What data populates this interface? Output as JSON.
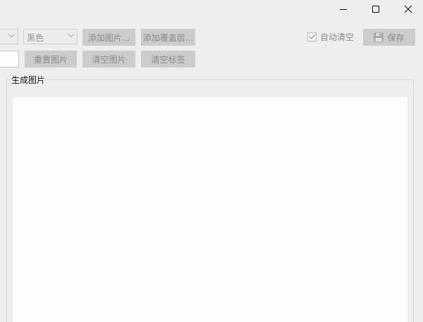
{
  "window": {
    "minimize_icon": "minimize-icon",
    "maximize_icon": "maximize-icon",
    "close_icon": "close-icon"
  },
  "toolbar": {
    "color_combo": {
      "value": "黑色"
    },
    "add_image_label": "添加图片...",
    "add_overlay_label": "添加覆盖层...",
    "reset_image_label": "重置图片",
    "clear_image_label": "清空图片",
    "clear_tags_label": "清空标签",
    "auto_clear_label": "自动清空",
    "auto_clear_checked": true,
    "save_label": "保存",
    "save_icon": "floppy-disk-icon"
  },
  "group": {
    "title": "生成图片"
  },
  "colors": {
    "window_bg": "#efeeef",
    "disabled_button_bg": "#cccccc",
    "disabled_text": "#8a8a8a",
    "canvas_bg": "#fefcfe"
  }
}
